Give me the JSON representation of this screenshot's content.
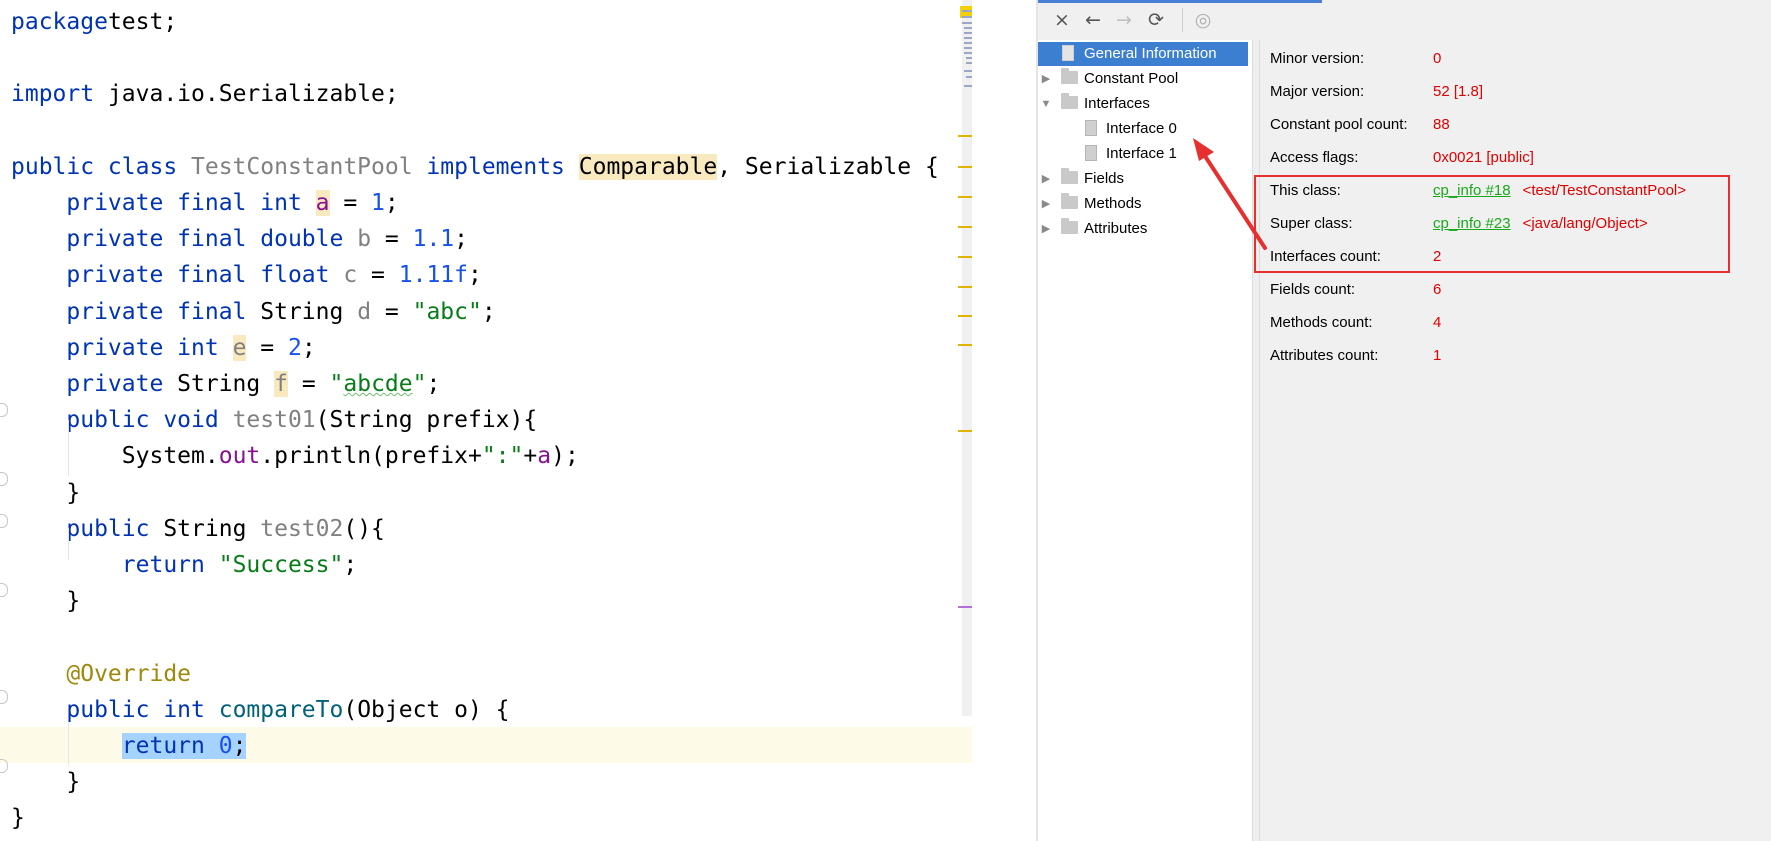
{
  "editor": {
    "lines": [
      {
        "tokens": [
          [
            "kw",
            "package"
          ],
          [
            "",
            "test;"
          ]
        ]
      },
      {
        "tokens": []
      },
      {
        "tokens": [
          [
            "kw",
            "import"
          ],
          [
            "",
            " java.io.Serializable;"
          ]
        ]
      },
      {
        "tokens": []
      },
      {
        "tokens": [
          [
            "kw",
            "public class "
          ],
          [
            "gray",
            "TestConstantPool"
          ],
          [
            "kw",
            " implements "
          ],
          [
            "hl-y",
            "Comparable"
          ],
          [
            "",
            ", Serializable {"
          ]
        ]
      },
      {
        "tokens": [
          [
            "kw",
            "    private final int "
          ],
          [
            "fld hl-y",
            "a"
          ],
          [
            "",
            " = "
          ],
          [
            "num",
            "1"
          ],
          [
            "",
            ";"
          ]
        ]
      },
      {
        "tokens": [
          [
            "kw",
            "    private final double "
          ],
          [
            "gray",
            "b"
          ],
          [
            "",
            " = "
          ],
          [
            "num",
            "1.1"
          ],
          [
            "",
            ";"
          ]
        ]
      },
      {
        "tokens": [
          [
            "kw",
            "    private final float "
          ],
          [
            "gray",
            "c"
          ],
          [
            "",
            " = "
          ],
          [
            "num",
            "1.11f"
          ],
          [
            "",
            ";"
          ]
        ]
      },
      {
        "tokens": [
          [
            "kw",
            "    private final "
          ],
          [
            "",
            "String "
          ],
          [
            "gray",
            "d"
          ],
          [
            "",
            " = "
          ],
          [
            "str",
            "\"abc\""
          ],
          [
            "",
            ";"
          ]
        ]
      },
      {
        "tokens": [
          [
            "kw",
            "    private int "
          ],
          [
            "gray hl-y",
            "e"
          ],
          [
            "",
            " = "
          ],
          [
            "num",
            "2"
          ],
          [
            "",
            ";"
          ]
        ]
      },
      {
        "tokens": [
          [
            "kw",
            "    private "
          ],
          [
            "",
            "String "
          ],
          [
            "gray hl-y",
            "f"
          ],
          [
            "",
            " = "
          ],
          [
            "str",
            "\""
          ],
          [
            "str squig",
            "abcde"
          ],
          [
            "str",
            "\""
          ],
          [
            "",
            ";"
          ]
        ]
      },
      {
        "tokens": [
          [
            "kw",
            "    public void "
          ],
          [
            "gray",
            "test01"
          ],
          [
            "",
            "(String prefix){"
          ]
        ]
      },
      {
        "tokens": [
          [
            "",
            "        System."
          ],
          [
            "fld",
            "out"
          ],
          [
            "",
            ".println(prefix+"
          ],
          [
            "str",
            "\":\""
          ],
          [
            "",
            "+"
          ],
          [
            "fld",
            "a"
          ],
          [
            "",
            ");"
          ]
        ]
      },
      {
        "tokens": [
          [
            "",
            "    }"
          ]
        ]
      },
      {
        "tokens": [
          [
            "kw",
            "    public "
          ],
          [
            "",
            "String "
          ],
          [
            "gray",
            "test02"
          ],
          [
            "",
            "(){"
          ]
        ]
      },
      {
        "tokens": [
          [
            "kw",
            "        return "
          ],
          [
            "str",
            "\"Success\""
          ],
          [
            "",
            ";"
          ]
        ]
      },
      {
        "tokens": [
          [
            "",
            "    }"
          ]
        ]
      },
      {
        "tokens": []
      },
      {
        "tokens": [
          [
            "ann",
            "    @Override"
          ]
        ]
      },
      {
        "tokens": [
          [
            "kw",
            "    public int "
          ],
          [
            "met",
            "compareTo"
          ],
          [
            "",
            "(Object o) {"
          ]
        ]
      },
      {
        "tokens": [
          [
            "",
            "        "
          ],
          [
            "kw hl-b",
            "return "
          ],
          [
            "num hl-b",
            "0"
          ],
          [
            "hl-b",
            ";"
          ]
        ]
      },
      {
        "tokens": [
          [
            "",
            "    }"
          ]
        ]
      },
      {
        "tokens": [
          [
            "",
            "}"
          ]
        ]
      }
    ]
  },
  "toolbar": {
    "close_icon": "×",
    "back_icon": "←",
    "forward_icon": "→",
    "refresh_icon": "⟳",
    "web_icon": "◎"
  },
  "tree": {
    "general": "General Information",
    "constant_pool": "Constant Pool",
    "interfaces": "Interfaces",
    "interface0": "Interface 0",
    "interface1": "Interface 1",
    "fields": "Fields",
    "methods": "Methods",
    "attributes": "Attributes"
  },
  "general_info": {
    "minor_version_label": "Minor version:",
    "minor_version": "0",
    "major_version_label": "Major version:",
    "major_version": "52 [1.8]",
    "cp_count_label": "Constant pool count:",
    "cp_count": "88",
    "access_flags_label": "Access flags:",
    "access_flags": "0x0021 [public]",
    "this_class_label": "This class:",
    "this_class_link": "cp_info #18",
    "this_class_name": "<test/TestConstantPool>",
    "super_class_label": "Super class:",
    "super_class_link": "cp_info #23",
    "super_class_name": "<java/lang/Object>",
    "interfaces_count_label": "Interfaces count:",
    "interfaces_count": "2",
    "fields_count_label": "Fields count:",
    "fields_count": "6",
    "methods_count_label": "Methods count:",
    "methods_count": "4",
    "attributes_count_label": "Attributes count:",
    "attributes_count": "1"
  },
  "colors": {
    "keyword": "#0033b3",
    "number": "#1750eb",
    "string": "#067d17",
    "selection": "#3c7fd0",
    "value_red": "#e00000",
    "link_green": "#1ba81b",
    "annotation_red": "#e63030"
  }
}
